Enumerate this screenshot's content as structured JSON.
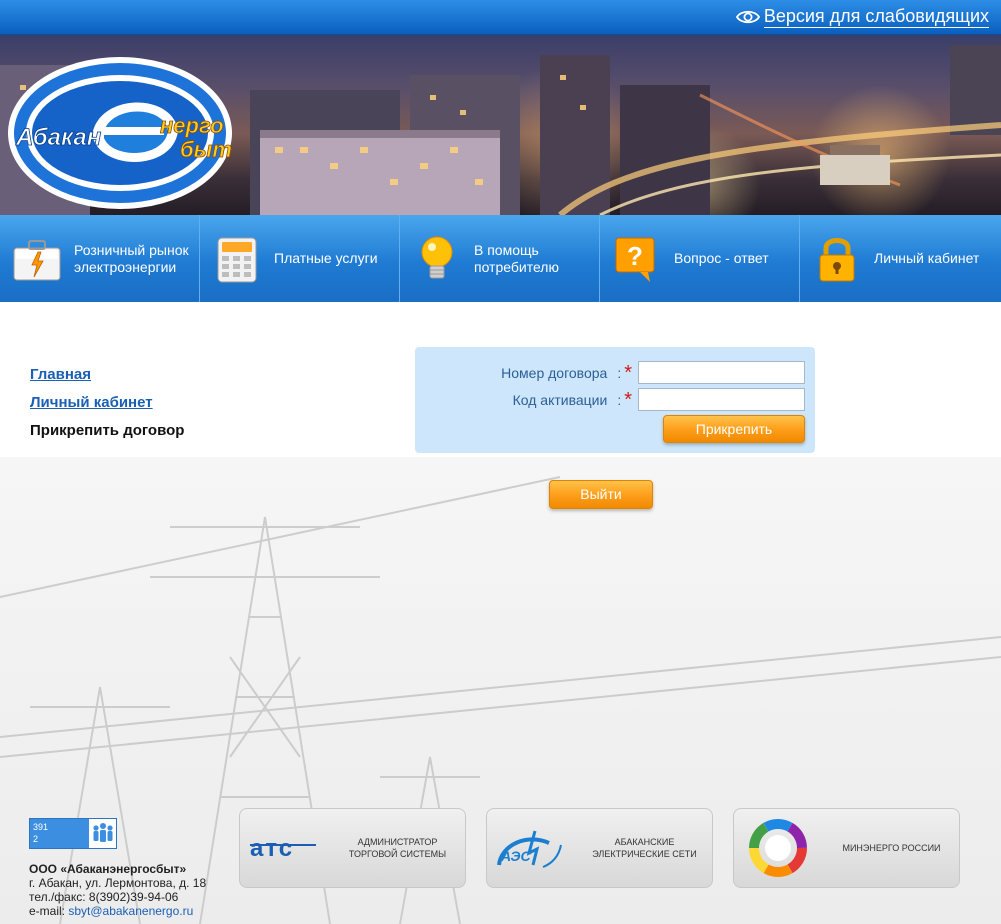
{
  "header": {
    "accessibility_label": "Версия для слабовидящих"
  },
  "logo": {
    "part_left": "Абакан",
    "part_top": "нерго",
    "part_bottom": "быт"
  },
  "nav": {
    "items": [
      {
        "line1": "Розничный рынок",
        "line2": "электроэнергии",
        "icon": "briefcase-icon"
      },
      {
        "line1": "Платные услуги",
        "line2": "",
        "icon": "calculator-icon"
      },
      {
        "line1": "В помощь",
        "line2": "потребителю",
        "icon": "lightbulb-icon"
      },
      {
        "line1": "Вопрос - ответ",
        "line2": "",
        "icon": "question-icon"
      },
      {
        "line1": "Личный кабинет",
        "line2": "",
        "icon": "lock-icon"
      }
    ]
  },
  "sidebar": {
    "links": [
      "Главная",
      "Личный кабинет"
    ],
    "current": "Прикрепить договор"
  },
  "form": {
    "contract_label": "Номер договора",
    "activation_label": "Код активации",
    "colon": ":",
    "required_mark": "*",
    "contract_value": "",
    "activation_value": "",
    "submit_label": "Прикрепить"
  },
  "logout_label": "Выйти",
  "counter": {
    "line1": "391",
    "line2": "2"
  },
  "company": {
    "name": "ООО «Абаканэнергосбыт»",
    "address": "г. Абакан, ул. Лермонтова, д. 18",
    "phone": "тел./факс: 8(3902)39-94-06",
    "email_prefix": "e-mail: ",
    "email": "sbyt@abakanenergo.ru"
  },
  "partners": [
    {
      "abbr": "атс",
      "line1": "АДМИНИСТРАТОР",
      "line2": "ТОРГОВОЙ СИСТЕМЫ",
      "icon": "ats-logo-icon"
    },
    {
      "abbr": "АЭС",
      "line1": "АБАКАНСКИЕ",
      "line2": "ЭЛЕКТРИЧЕСКИЕ СЕТИ",
      "icon": "aes-logo-icon"
    },
    {
      "abbr": "",
      "line1": "МИНЭНЕРГО РОССИИ",
      "line2": "",
      "icon": "minenergo-logo-icon"
    }
  ]
}
